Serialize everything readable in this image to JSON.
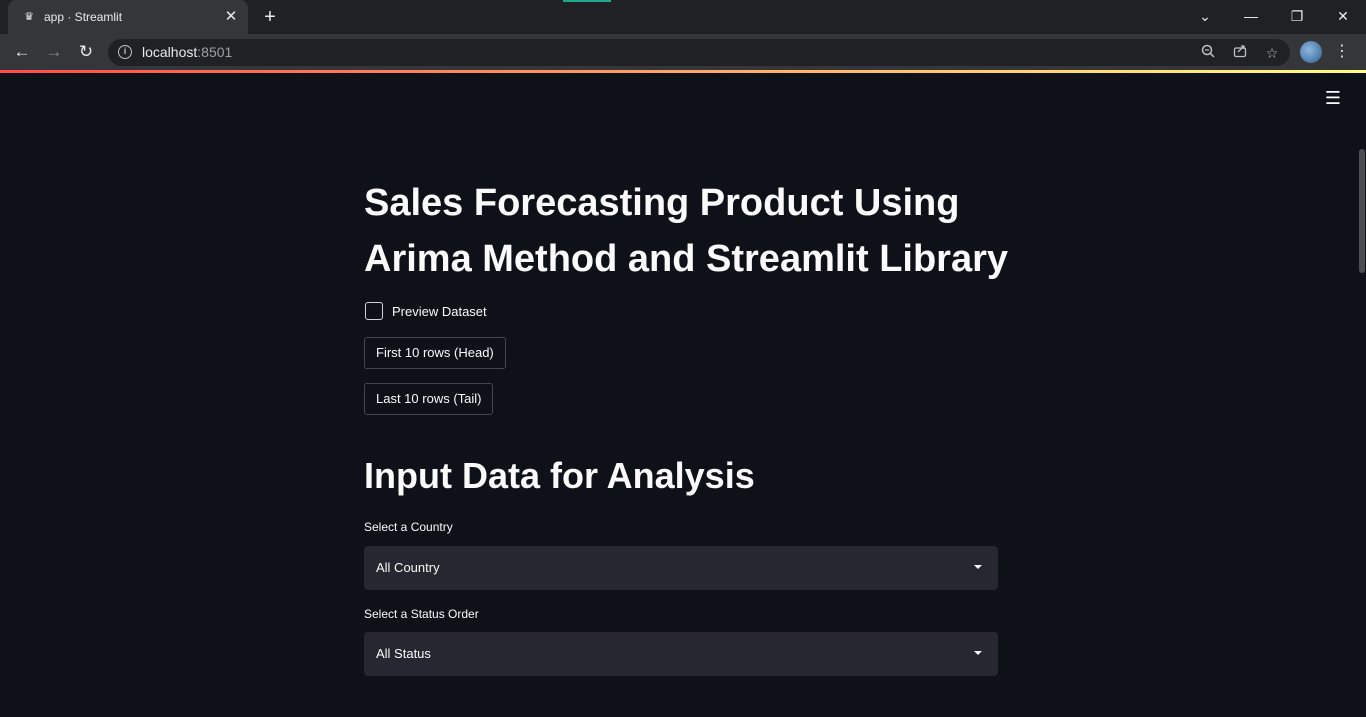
{
  "browser": {
    "tab": {
      "title": "app · Streamlit",
      "favicon": "streamlit-crown-icon",
      "close": "✕"
    },
    "new_tab": "+",
    "window_controls": {
      "dropdown": "⌄",
      "minimize": "—",
      "restore": "❐",
      "close": "✕"
    },
    "url": {
      "host": "localhost",
      "port": ":8501"
    },
    "accent_color": "#1ba88b"
  },
  "app": {
    "title": "Sales Forecasting Product Using Arima Method and Streamlit Library",
    "preview_checkbox_label": "Preview Dataset",
    "head_button": "First 10 rows (Head)",
    "tail_button": "Last 10 rows (Tail)",
    "section_heading": "Input Data for Analysis",
    "country_select": {
      "label": "Select a Country",
      "value": "All Country"
    },
    "status_select": {
      "label": "Select a Status Order",
      "value": "All Status"
    },
    "colors": {
      "background": "#0e1117",
      "input": "#262730",
      "text": "#fafafa",
      "decoration_start": "#ff4b4b",
      "decoration_end": "#fffd80"
    }
  }
}
